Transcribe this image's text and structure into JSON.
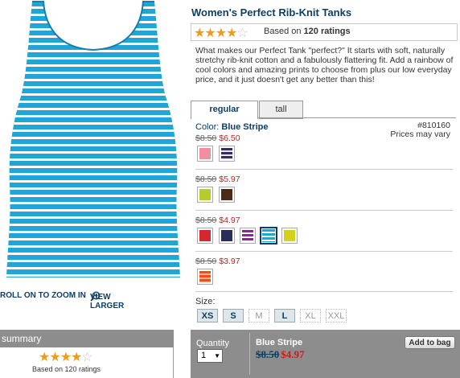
{
  "product": {
    "title": "Women's Perfect Rib-Knit Tanks",
    "rating_value": 4,
    "rating_max": 5,
    "rating_text_prefix": "Based on",
    "rating_count": "120 ratings",
    "description": "What makes our Perfect Tank \"perfect?\" It starts with soft, naturally stretchy rib-knit cotton and a fabulously flattering fit. Add a rainbow of cool colors and amazing prints to choose from plus our low everyday price, and it just doesn't get any better than this!",
    "image_colors": {
      "base": "#1fa5d8",
      "stripe": "#ffffff"
    }
  },
  "image_controls": {
    "zoom_label": "ROLL ON TO ZOOM IN",
    "view_larger_label": "VIEW LARGER"
  },
  "summary": {
    "header": "summary",
    "rating_value": 4,
    "rating_text": "Based on 120 ratings"
  },
  "tabs": [
    {
      "label": "regular",
      "active": true
    },
    {
      "label": "tall",
      "active": false
    }
  ],
  "color_prefix": "Color:",
  "selected_color": "Blue Stripe",
  "sku": "#810160",
  "prices_note": "Prices may vary",
  "price_groups": [
    {
      "was": "$8.50",
      "now": "$6.50",
      "swatches": [
        {
          "name": "pink",
          "color": "#f08fa0"
        },
        {
          "name": "navy-stripe",
          "color": "#3b2a5c",
          "stripe": "#e8e8f0"
        }
      ]
    },
    {
      "was": "$8.50",
      "now": "$5.97",
      "swatches": [
        {
          "name": "lime",
          "color": "#b6cc2a"
        },
        {
          "name": "brown",
          "color": "#4b2a18"
        }
      ]
    },
    {
      "was": "$8.50",
      "now": "$4.97",
      "swatches": [
        {
          "name": "red",
          "color": "#d8262e"
        },
        {
          "name": "navy",
          "color": "#2a2d5a"
        },
        {
          "name": "purple-stripe",
          "color": "#7b2f8a",
          "stripe": "#ffffff"
        },
        {
          "name": "blue-stripe",
          "color": "#1fa5d8",
          "stripe": "#ffffff",
          "selected": true
        },
        {
          "name": "yellow-green",
          "color": "#d4d11c"
        }
      ]
    },
    {
      "was": "$8.50",
      "now": "$3.97",
      "swatches": [
        {
          "name": "orange-stripe",
          "color": "#e8501e",
          "stripe": "#f7b08a"
        }
      ]
    }
  ],
  "size_label": "Size:",
  "sizes": [
    {
      "label": "XS",
      "available": true
    },
    {
      "label": "S",
      "available": true
    },
    {
      "label": "M",
      "available": false
    },
    {
      "label": "L",
      "available": true
    },
    {
      "label": "XL",
      "available": false
    },
    {
      "label": "XXL",
      "available": false
    }
  ],
  "cart": {
    "quantity_label": "Quantity",
    "quantity_value": "1",
    "color_name": "Blue Stripe",
    "was": "$8.50",
    "now": "$4.97",
    "add_label": "Add to bag"
  },
  "colors": {
    "brand_blue": "#0d3e66",
    "sale_red": "#cc1b1b",
    "star": "#f29a1e",
    "bar_gray": "#8d8d8d"
  }
}
